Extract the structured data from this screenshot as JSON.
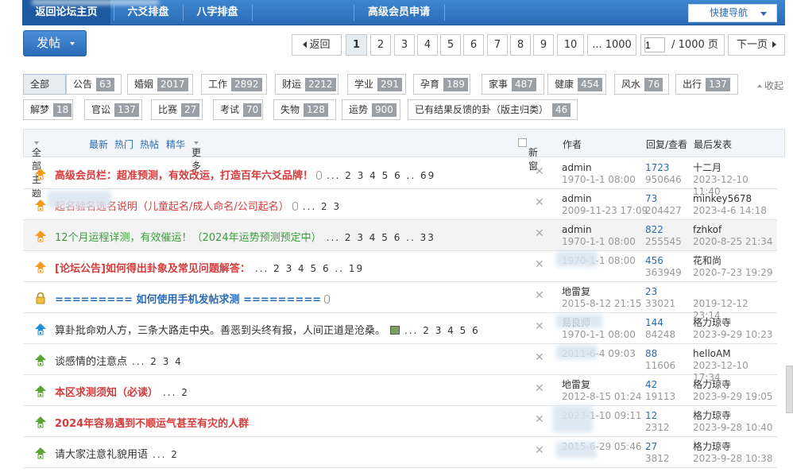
{
  "topnav": {
    "items": [
      "返回论坛主页",
      "六爻排盘",
      "八字排盘",
      "高级会员申请"
    ],
    "quick_nav": "快捷导航"
  },
  "post_button": "发帖",
  "pager": {
    "prev": "返回",
    "pages": [
      "1",
      "2",
      "3",
      "4",
      "5",
      "6",
      "7",
      "8",
      "9",
      "10"
    ],
    "current": "1",
    "last": "... 1000",
    "input_value": "1",
    "total": "/ 1000 页",
    "next": "下一页"
  },
  "type_filters": [
    {
      "label": "全部",
      "count": ""
    },
    {
      "label": "公告",
      "count": "63"
    },
    {
      "label": "婚姻",
      "count": "2017"
    },
    {
      "label": "工作",
      "count": "2892"
    },
    {
      "label": "财运",
      "count": "2212"
    },
    {
      "label": "学业",
      "count": "291"
    },
    {
      "label": "孕育",
      "count": "189"
    },
    {
      "label": "家事",
      "count": "487"
    },
    {
      "label": "健康",
      "count": "454"
    },
    {
      "label": "风水",
      "count": "76"
    },
    {
      "label": "出行",
      "count": "137"
    },
    {
      "label": "解梦",
      "count": "18"
    },
    {
      "label": "官讼",
      "count": "137"
    },
    {
      "label": "比赛",
      "count": "27"
    },
    {
      "label": "考试",
      "count": "70"
    },
    {
      "label": "失物",
      "count": "128"
    },
    {
      "label": "运势",
      "count": "900"
    },
    {
      "label": "已有结果反馈的卦（版主归类）",
      "count": "46"
    }
  ],
  "collapse": "收起",
  "table_header": {
    "all_topics": "全部主题",
    "latest": "最新",
    "hot": "热门",
    "hot_posts": "热帖",
    "digest": "精华",
    "more": "更多",
    "new_window": "新窗",
    "author": "作者",
    "replies_views": "回复/查看",
    "last_post": "最后发表"
  },
  "threads": [
    {
      "title": "高级会员栏：超准预测，有效改运，打造百年六爻品牌！",
      "pages": "... 2 3 4 5 6 .. 69",
      "color": "#d63b3b",
      "bold": true,
      "icon": "orange-up-lock",
      "attach": true,
      "author": "admin",
      "author_time": "1970-1-1 08:00",
      "replies": "1723",
      "views": "950646",
      "last_user": "十二月",
      "last_time": "2023-12-10 11:40"
    },
    {
      "title": "起名验名选名说明（儿童起名/成人命名/公司起名）",
      "pages": "... 2 3",
      "color": "#d63b3b",
      "bold": false,
      "icon": "orange-up-lock",
      "attach": true,
      "author": "admin",
      "author_time": "2009-11-23 17:09",
      "replies": "73",
      "views": "204427",
      "last_user": "minkey5678",
      "last_time": "2023-4-6 14:18"
    },
    {
      "title": "12个月运程详测，有效催运！（2024年运势预测预定中）",
      "pages": "... 2 3 4 5 6 .. 33",
      "color": "#3a9d3a",
      "bold": false,
      "icon": "orange-up-lock",
      "attach": false,
      "author": "admin",
      "author_time": "1970-1-1 08:00",
      "replies": "822",
      "views": "255545",
      "last_user": "fzhkof",
      "last_time": "2020-8-25 21:34"
    },
    {
      "title": "[论坛公告]如何得出卦象及常见问题解答：",
      "pages": "... 2 3 4 5 6 .. 19",
      "color": "#d63b3b",
      "bold": true,
      "icon": "orange-up-lock",
      "attach": false,
      "author": "",
      "author_time": "1970-1-1 08:00",
      "replies": "456",
      "views": "363949",
      "last_user": "花和尚",
      "last_time": "2020-7-23 19:29"
    },
    {
      "title": "========= 如何使用手机发帖求测 =========",
      "pages": "",
      "color": "#2a6bb6",
      "bold": true,
      "icon": "lock-closed",
      "attach": true,
      "author": "地雷复",
      "author_time": "2015-8-12 21:15",
      "replies": "23",
      "views": "33021",
      "last_user": "",
      "last_time": "2019-12-12 23:14"
    },
    {
      "title": "算卦批命劝人方，三条大路走中央。善恶到头终有报，人间正道是沧桑。",
      "pages": "... 2 3 4 5 6",
      "color": "#333333",
      "bold": false,
      "icon": "blue-up-lock",
      "attach": false,
      "image": true,
      "author": "易良师",
      "author_time": "1970-1-1 08:00",
      "replies": "144",
      "views": "84248",
      "last_user": "格力琼寺",
      "last_time": "2023-9-29 10:23"
    },
    {
      "title": "谈感情的注意点",
      "pages": "... 2 3 4",
      "color": "#333333",
      "bold": false,
      "icon": "green-up-lock",
      "attach": false,
      "author": "",
      "author_time": "2011-6-4 09:03",
      "replies": "88",
      "views": "11606",
      "last_user": "helloAM",
      "last_time": "2023-12-10 17:34"
    },
    {
      "title": "本区求测须知（必读）",
      "pages": "... 2",
      "color": "#d63b3b",
      "bold": true,
      "icon": "green-up-lock",
      "attach": false,
      "author": "地雷复",
      "author_time": "2012-8-15 01:24",
      "replies": "42",
      "views": "19113",
      "last_user": "格力琼寺",
      "last_time": "2023-9-29 19:05"
    },
    {
      "title": "2024年容易遇到不顺运气甚至有灾的人群",
      "pages": "",
      "color": "#d63b3b",
      "bold": true,
      "icon": "green-up-lock",
      "attach": false,
      "author": "",
      "author_time": "2023-1-10 09:11",
      "replies": "12",
      "views": "2312",
      "last_user": "格力琼寺",
      "last_time": "2023-9-28 10:40"
    },
    {
      "title": "请大家注意礼貌用语",
      "pages": "... 2",
      "color": "#333333",
      "bold": false,
      "icon": "green-up-lock",
      "attach": false,
      "author": "",
      "author_time": "2015-6-29 05:46",
      "replies": "27",
      "views": "3812",
      "last_user": "格力琼寺",
      "last_time": "2023-9-28 10:38"
    }
  ]
}
